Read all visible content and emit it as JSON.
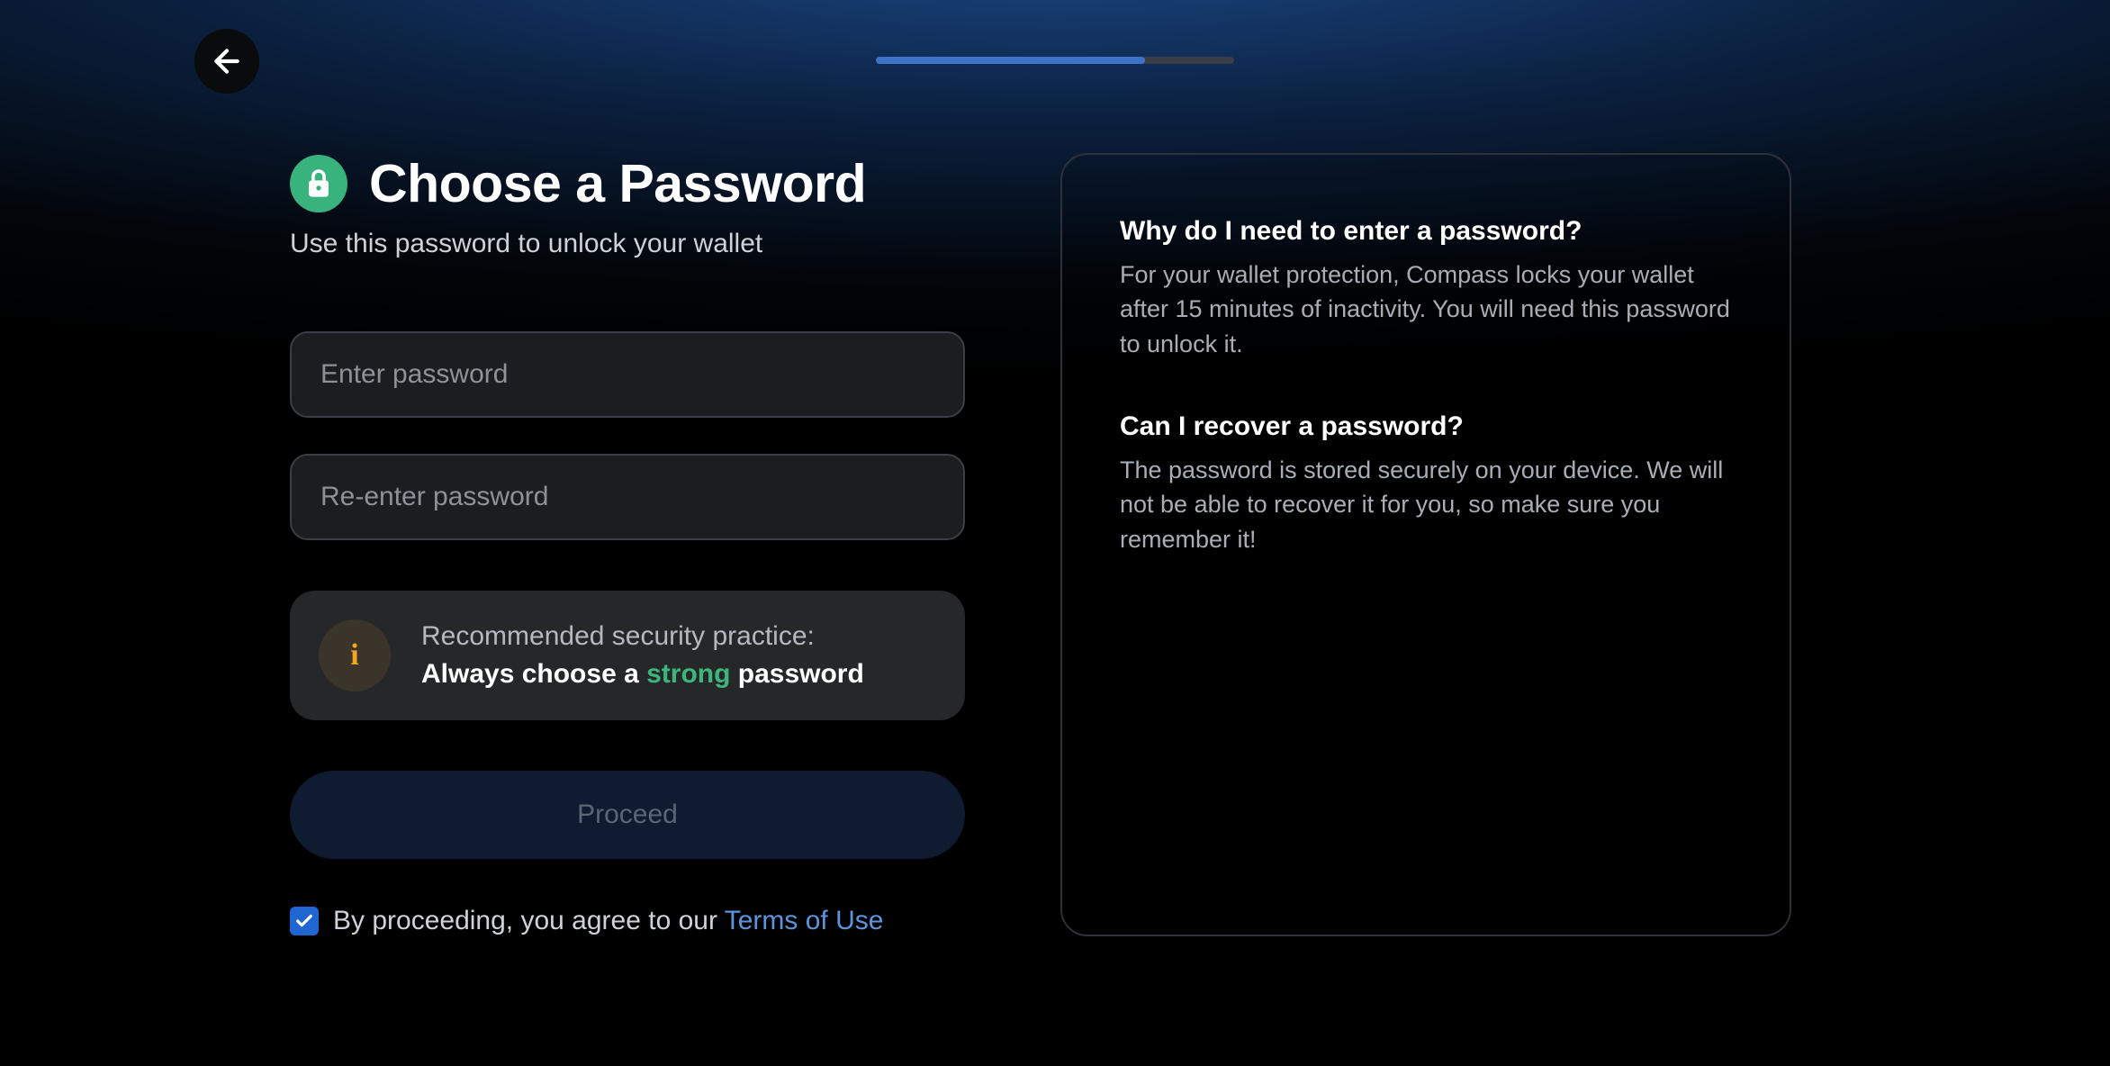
{
  "progress": {
    "percent": 75
  },
  "header": {
    "title": "Choose a Password",
    "subtitle": "Use this password to unlock your wallet"
  },
  "form": {
    "password_placeholder": "Enter password",
    "confirm_placeholder": "Re-enter password"
  },
  "tip": {
    "lead": "Recommended security practice:",
    "before": "Always choose a ",
    "strong": "strong",
    "after": " password"
  },
  "actions": {
    "proceed_label": "Proceed"
  },
  "terms": {
    "checked": true,
    "text": "By proceeding, you agree to our ",
    "link": "Terms of Use"
  },
  "faq": [
    {
      "q": "Why do I need to enter a password?",
      "a": "For your wallet protection, Compass locks your wallet after 15 minutes of inactivity. You will need this password to unlock it."
    },
    {
      "q": "Can I recover a password?",
      "a": "The password is stored securely on your device. We will not be able to recover it for you, so make sure you remember it!"
    }
  ]
}
